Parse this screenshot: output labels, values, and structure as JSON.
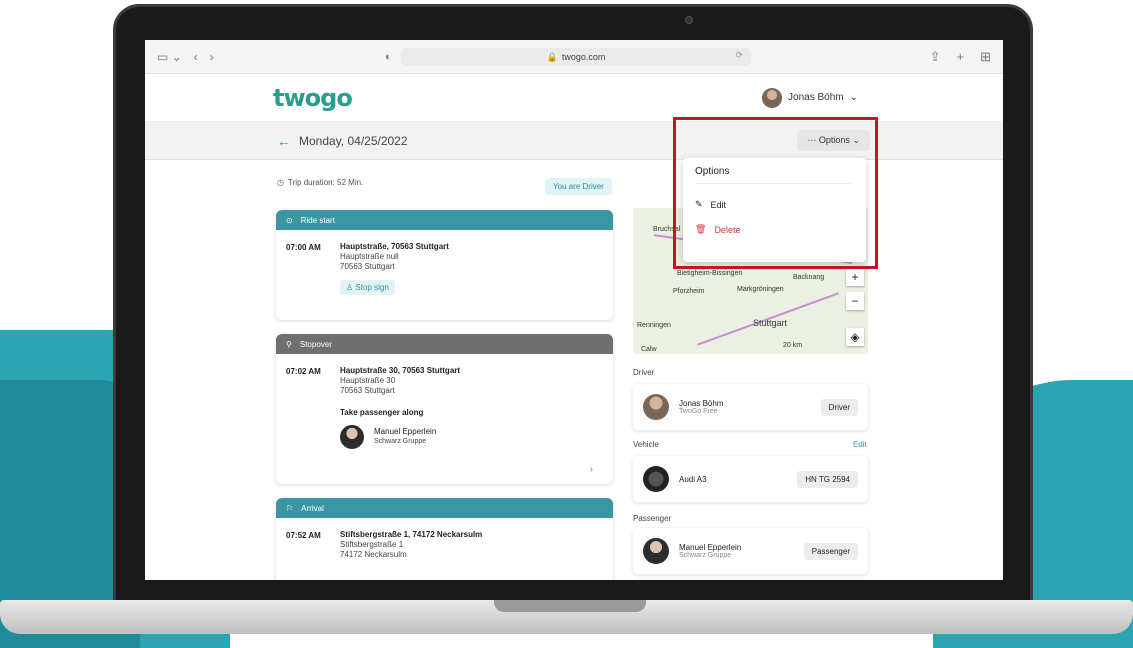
{
  "browser": {
    "url": "twogo.com"
  },
  "app": {
    "logo": "twogo",
    "user_name": "Jonas Böhm"
  },
  "subbar": {
    "date": "Monday, 04/25/2022",
    "options_label": "··· Options"
  },
  "trip": {
    "duration": "Trip duration: 52 Min.",
    "role_badge": "You are Driver"
  },
  "cards": {
    "start": {
      "header": "Ride start",
      "time": "07:00 AM",
      "title": "Hauptstraße, 70563 Stuttgart",
      "line1": "Hauptstraße null",
      "line2": "70563 Stuttgart",
      "chip": "Stop sign"
    },
    "stopover": {
      "header": "Stopover",
      "time": "07:02 AM",
      "title": "Hauptstraße 30, 70563 Stuttgart",
      "line1": "Hauptstraße 30",
      "line2": "70563 Stuttgart",
      "note": "Take passenger along",
      "passenger_name": "Manuel Epperlein",
      "passenger_company": "Schwarz Gruppe"
    },
    "arrival": {
      "header": "Arrival",
      "time": "07:52 AM",
      "title": "Stiftsbergstraße 1, 74172 Neckarsulm",
      "line1": "Stiftsbergstraße 1",
      "line2": "74172 Neckarsulm"
    }
  },
  "map": {
    "cities": [
      "Bruchsal",
      "Bietigheim-Bissingen",
      "Backnang",
      "Pforzheim",
      "Markgröningen",
      "Renningen",
      "Stuttgart",
      "Calw"
    ],
    "scale": "20 km"
  },
  "right": {
    "driver_label": "Driver",
    "driver_name": "Jonas Böhm",
    "driver_plan": "TwoGo Free",
    "driver_tag": "Driver",
    "vehicle_label": "Vehicle",
    "vehicle_edit": "Edit",
    "vehicle_name": "Audi A3",
    "vehicle_plate": "HN TG 2594",
    "passenger_label": "Passenger",
    "passenger_name": "Manuel Epperlein",
    "passenger_company": "Schwarz Gruppe",
    "passenger_tag": "Passenger"
  },
  "dropdown": {
    "title": "Options",
    "edit": "Edit",
    "delete": "Delete"
  },
  "colors": {
    "brand_teal": "#2a9d8f",
    "card_teal": "#3a96a3",
    "highlight_red": "#c4161c",
    "delete_red": "#d9363e"
  }
}
